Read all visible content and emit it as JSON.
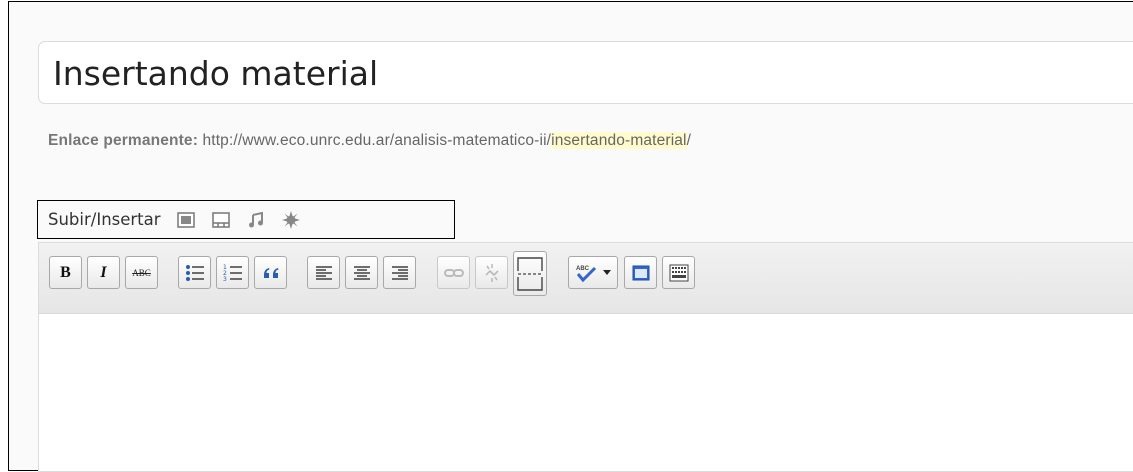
{
  "post": {
    "title": "Insertando material",
    "permalink_label": "Enlace permanente:",
    "permalink_base": "http://www.eco.unrc.edu.ar/analisis-matematico-ii/",
    "permalink_slug": "insertando-material",
    "permalink_end": "/"
  },
  "media": {
    "label": "Subir/Insertar",
    "icons": [
      "image-icon",
      "video-icon",
      "music-icon",
      "media-icon"
    ]
  },
  "toolbar": {
    "bold_label": "B",
    "italic_label": "I",
    "strike_label": "ABC",
    "buttons": [
      "bold",
      "italic",
      "strikethrough",
      "bullet-list",
      "numbered-list",
      "blockquote",
      "align-left",
      "align-center",
      "align-right",
      "insert-link",
      "unlink",
      "insert-more",
      "spellcheck",
      "fullscreen",
      "kitchen-sink"
    ],
    "disabled": [
      "insert-link",
      "unlink"
    ]
  },
  "colors": {
    "permalink_highlight": "#fffbcc",
    "blue_accent": "#3366cc"
  }
}
